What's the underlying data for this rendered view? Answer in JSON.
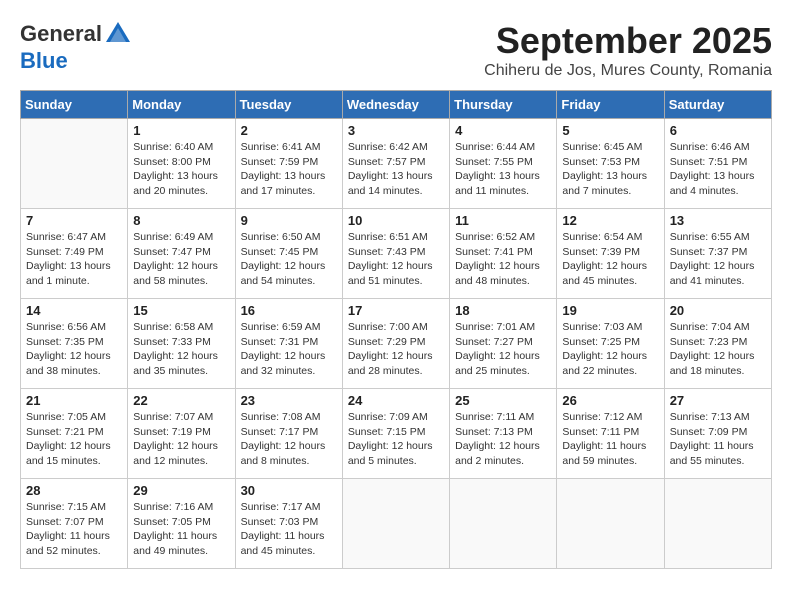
{
  "logo": {
    "general": "General",
    "blue": "Blue"
  },
  "title": "September 2025",
  "subtitle": "Chiheru de Jos, Mures County, Romania",
  "days_of_week": [
    "Sunday",
    "Monday",
    "Tuesday",
    "Wednesday",
    "Thursday",
    "Friday",
    "Saturday"
  ],
  "weeks": [
    [
      {
        "day": "",
        "info": ""
      },
      {
        "day": "1",
        "info": "Sunrise: 6:40 AM\nSunset: 8:00 PM\nDaylight: 13 hours\nand 20 minutes."
      },
      {
        "day": "2",
        "info": "Sunrise: 6:41 AM\nSunset: 7:59 PM\nDaylight: 13 hours\nand 17 minutes."
      },
      {
        "day": "3",
        "info": "Sunrise: 6:42 AM\nSunset: 7:57 PM\nDaylight: 13 hours\nand 14 minutes."
      },
      {
        "day": "4",
        "info": "Sunrise: 6:44 AM\nSunset: 7:55 PM\nDaylight: 13 hours\nand 11 minutes."
      },
      {
        "day": "5",
        "info": "Sunrise: 6:45 AM\nSunset: 7:53 PM\nDaylight: 13 hours\nand 7 minutes."
      },
      {
        "day": "6",
        "info": "Sunrise: 6:46 AM\nSunset: 7:51 PM\nDaylight: 13 hours\nand 4 minutes."
      }
    ],
    [
      {
        "day": "7",
        "info": "Sunrise: 6:47 AM\nSunset: 7:49 PM\nDaylight: 13 hours\nand 1 minute."
      },
      {
        "day": "8",
        "info": "Sunrise: 6:49 AM\nSunset: 7:47 PM\nDaylight: 12 hours\nand 58 minutes."
      },
      {
        "day": "9",
        "info": "Sunrise: 6:50 AM\nSunset: 7:45 PM\nDaylight: 12 hours\nand 54 minutes."
      },
      {
        "day": "10",
        "info": "Sunrise: 6:51 AM\nSunset: 7:43 PM\nDaylight: 12 hours\nand 51 minutes."
      },
      {
        "day": "11",
        "info": "Sunrise: 6:52 AM\nSunset: 7:41 PM\nDaylight: 12 hours\nand 48 minutes."
      },
      {
        "day": "12",
        "info": "Sunrise: 6:54 AM\nSunset: 7:39 PM\nDaylight: 12 hours\nand 45 minutes."
      },
      {
        "day": "13",
        "info": "Sunrise: 6:55 AM\nSunset: 7:37 PM\nDaylight: 12 hours\nand 41 minutes."
      }
    ],
    [
      {
        "day": "14",
        "info": "Sunrise: 6:56 AM\nSunset: 7:35 PM\nDaylight: 12 hours\nand 38 minutes."
      },
      {
        "day": "15",
        "info": "Sunrise: 6:58 AM\nSunset: 7:33 PM\nDaylight: 12 hours\nand 35 minutes."
      },
      {
        "day": "16",
        "info": "Sunrise: 6:59 AM\nSunset: 7:31 PM\nDaylight: 12 hours\nand 32 minutes."
      },
      {
        "day": "17",
        "info": "Sunrise: 7:00 AM\nSunset: 7:29 PM\nDaylight: 12 hours\nand 28 minutes."
      },
      {
        "day": "18",
        "info": "Sunrise: 7:01 AM\nSunset: 7:27 PM\nDaylight: 12 hours\nand 25 minutes."
      },
      {
        "day": "19",
        "info": "Sunrise: 7:03 AM\nSunset: 7:25 PM\nDaylight: 12 hours\nand 22 minutes."
      },
      {
        "day": "20",
        "info": "Sunrise: 7:04 AM\nSunset: 7:23 PM\nDaylight: 12 hours\nand 18 minutes."
      }
    ],
    [
      {
        "day": "21",
        "info": "Sunrise: 7:05 AM\nSunset: 7:21 PM\nDaylight: 12 hours\nand 15 minutes."
      },
      {
        "day": "22",
        "info": "Sunrise: 7:07 AM\nSunset: 7:19 PM\nDaylight: 12 hours\nand 12 minutes."
      },
      {
        "day": "23",
        "info": "Sunrise: 7:08 AM\nSunset: 7:17 PM\nDaylight: 12 hours\nand 8 minutes."
      },
      {
        "day": "24",
        "info": "Sunrise: 7:09 AM\nSunset: 7:15 PM\nDaylight: 12 hours\nand 5 minutes."
      },
      {
        "day": "25",
        "info": "Sunrise: 7:11 AM\nSunset: 7:13 PM\nDaylight: 12 hours\nand 2 minutes."
      },
      {
        "day": "26",
        "info": "Sunrise: 7:12 AM\nSunset: 7:11 PM\nDaylight: 11 hours\nand 59 minutes."
      },
      {
        "day": "27",
        "info": "Sunrise: 7:13 AM\nSunset: 7:09 PM\nDaylight: 11 hours\nand 55 minutes."
      }
    ],
    [
      {
        "day": "28",
        "info": "Sunrise: 7:15 AM\nSunset: 7:07 PM\nDaylight: 11 hours\nand 52 minutes."
      },
      {
        "day": "29",
        "info": "Sunrise: 7:16 AM\nSunset: 7:05 PM\nDaylight: 11 hours\nand 49 minutes."
      },
      {
        "day": "30",
        "info": "Sunrise: 7:17 AM\nSunset: 7:03 PM\nDaylight: 11 hours\nand 45 minutes."
      },
      {
        "day": "",
        "info": ""
      },
      {
        "day": "",
        "info": ""
      },
      {
        "day": "",
        "info": ""
      },
      {
        "day": "",
        "info": ""
      }
    ]
  ]
}
